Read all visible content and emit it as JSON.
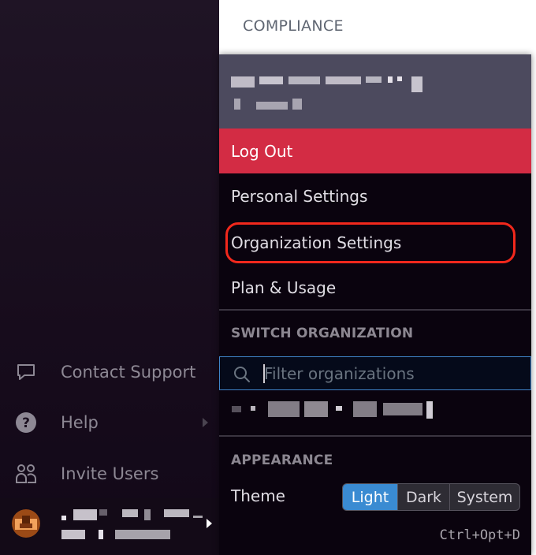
{
  "page": {
    "section_heading": "COMPLIANCE"
  },
  "sidebar": {
    "items": [
      {
        "label": "Contact Support",
        "icon": "chat-bubble-icon"
      },
      {
        "label": "Help",
        "icon": "question-circle-icon",
        "has_submenu": true
      },
      {
        "label": "Invite Users",
        "icon": "users-icon"
      }
    ],
    "user": {
      "name": "[redacted]",
      "subtitle": "[redacted]",
      "avatar_color": "#9b4a16"
    }
  },
  "menu": {
    "header": {
      "account_name": "[redacted]",
      "account_detail": "[redacted]"
    },
    "logout_label": "Log Out",
    "items": [
      {
        "label": "Personal Settings"
      },
      {
        "label": "Organization Settings",
        "highlighted": true
      },
      {
        "label": "Plan & Usage"
      }
    ],
    "switch_org": {
      "title": "SWITCH ORGANIZATION",
      "filter_placeholder": "Filter organizations",
      "filter_value": "",
      "organizations": [
        {
          "name": "[redacted]"
        }
      ]
    },
    "appearance": {
      "title": "APPEARANCE",
      "theme_label": "Theme",
      "options": [
        "Light",
        "Dark",
        "System"
      ],
      "selected": "Light",
      "shortcut": "Ctrl+Opt+D"
    }
  },
  "colors": {
    "logout_bg": "#d32c44",
    "header_bg": "#4c4a5e",
    "accent": "#3a8bd2",
    "highlight_ring": "#f2281c"
  }
}
